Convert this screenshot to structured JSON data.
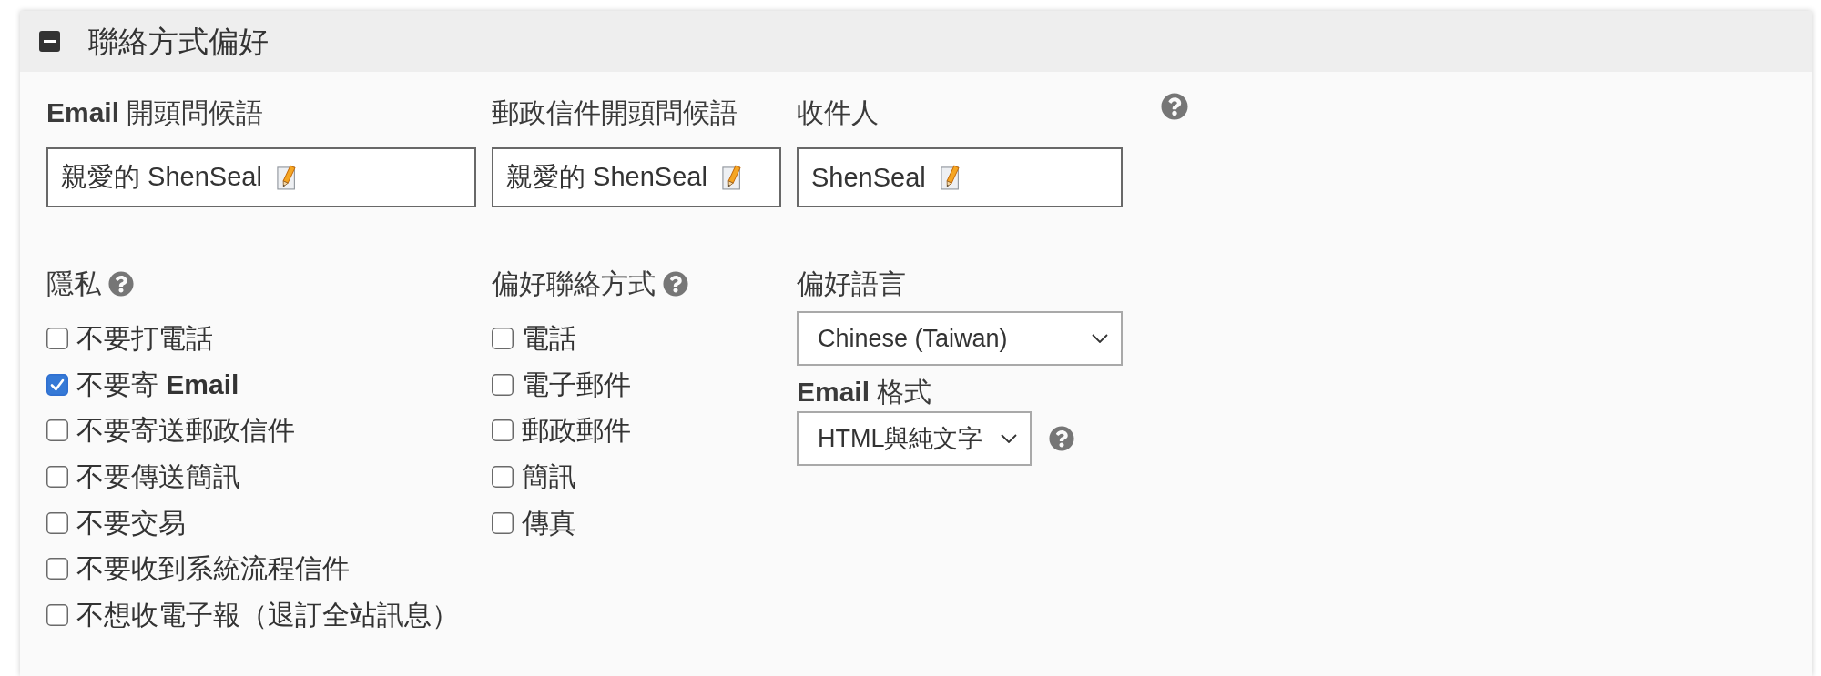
{
  "panel": {
    "title": "聯絡方式偏好",
    "expanded": true
  },
  "greetings": {
    "help": true,
    "fields": [
      {
        "label": "**Email** 開頭問候語",
        "value": "親愛的 ShenSeal"
      },
      {
        "label": "郵政信件開頭問候語",
        "value": "親愛的 ShenSeal"
      },
      {
        "label": "收件人",
        "value": "ShenSeal"
      }
    ]
  },
  "privacy": {
    "label": "隱私",
    "help": true,
    "options": [
      {
        "label": "不要打電話",
        "checked": false
      },
      {
        "label": "不要寄 **Email**",
        "checked": true
      },
      {
        "label": "不要寄送郵政信件",
        "checked": false
      },
      {
        "label": "不要傳送簡訊",
        "checked": false
      },
      {
        "label": "不要交易",
        "checked": false
      },
      {
        "label": "不要收到系統流程信件",
        "checked": false
      },
      {
        "label": "不想收電子報（退訂全站訊息）",
        "checked": false
      }
    ]
  },
  "preferred_contact": {
    "label": "偏好聯絡方式",
    "help": true,
    "options": [
      {
        "label": "電話",
        "checked": false
      },
      {
        "label": "電子郵件",
        "checked": false
      },
      {
        "label": "郵政郵件",
        "checked": false
      },
      {
        "label": "簡訊",
        "checked": false
      },
      {
        "label": "傳真",
        "checked": false
      }
    ]
  },
  "preferred_language": {
    "label": "偏好語言",
    "value": "Chinese (Taiwan)"
  },
  "email_format": {
    "label": "**Email** 格式",
    "value": "HTML與純文字",
    "help": true
  }
}
